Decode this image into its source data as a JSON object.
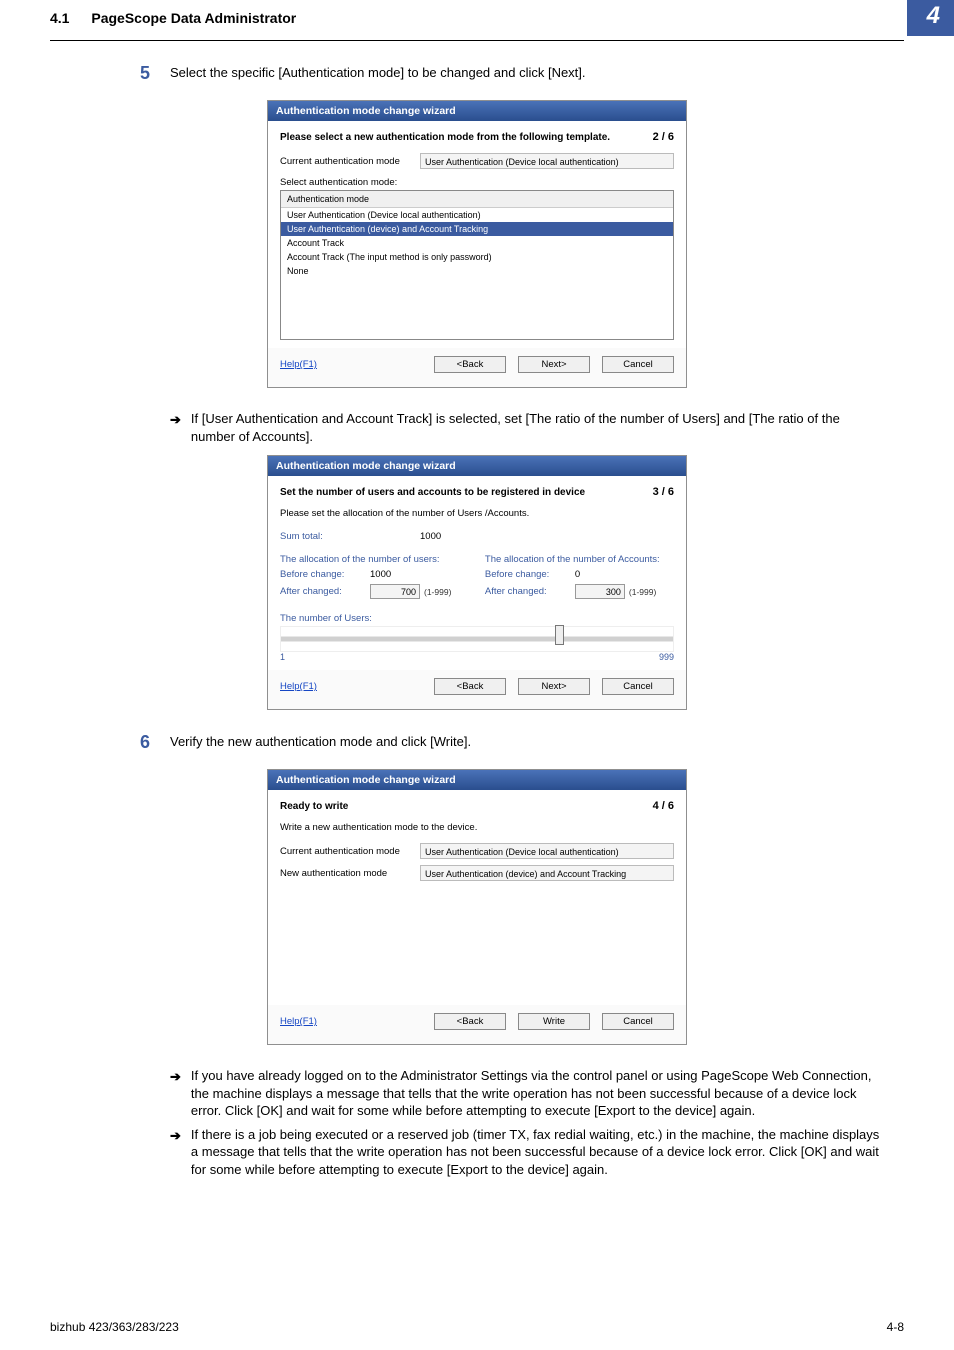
{
  "header": {
    "section": "4.1",
    "title": "PageScope Data Administrator",
    "chapter": "4"
  },
  "step5": {
    "num": "5",
    "text": "Select the specific [Authentication mode] to be changed and click [Next]."
  },
  "wizard1": {
    "title": "Authentication mode change wizard",
    "subtitle": "Please select a new authentication mode from the following template.",
    "page": "2 / 6",
    "current_label": "Current authentication mode",
    "current_value": "User Authentication (Device local authentication)",
    "select_label": "Select authentication mode:",
    "list_header": "Authentication mode",
    "items": [
      "User Authentication (Device local authentication)",
      "User Authentication (device) and Account Tracking",
      "Account Track",
      "Account Track (The input method is only password)",
      "None"
    ],
    "back": "<Back",
    "next": "Next>",
    "cancel": "Cancel",
    "help": "Help(F1)"
  },
  "arrow1": {
    "text": "If [User Authentication and Account Track] is selected, set [The ratio of the number of Users] and [The ratio of the number of Accounts]."
  },
  "wizard2": {
    "title": "Authentication mode change wizard",
    "subtitle": "Set the number of users and accounts to be registered in device",
    "page": "3 / 6",
    "caption": "Please set the allocation of the number of Users /Accounts.",
    "sum_label": "Sum total:",
    "sum_value": "1000",
    "users_heading": "The allocation of the number of users:",
    "accounts_heading": "The allocation of the number of Accounts:",
    "before_label": "Before change:",
    "after_label": "After changed:",
    "users_before": "1000",
    "users_after": "700",
    "users_range": "(1-999)",
    "accounts_before": "0",
    "accounts_after": "300",
    "accounts_range": "(1-999)",
    "slider_title": "The number of Users:",
    "slider_min": "1",
    "slider_max": "999",
    "back": "<Back",
    "next": "Next>",
    "cancel": "Cancel",
    "help": "Help(F1)"
  },
  "step6": {
    "num": "6",
    "text": "Verify the new authentication mode and click [Write]."
  },
  "wizard3": {
    "title": "Authentication mode change wizard",
    "subtitle": "Ready to write",
    "page": "4 / 6",
    "caption": "Write a new authentication mode to the device.",
    "current_label": "Current authentication mode",
    "current_value": "User Authentication (Device local authentication)",
    "new_label": "New authentication mode",
    "new_value": "User Authentication (device) and Account Tracking",
    "back": "<Back",
    "write": "Write",
    "cancel": "Cancel",
    "help": "Help(F1)"
  },
  "arrow2": {
    "text": "If you have already logged on to the Administrator Settings via the control panel or using PageScope Web Connection, the machine displays a message that tells that the write operation has not been successful because of a device lock error. Click [OK] and wait for some while before attempting to execute [Export to the device] again."
  },
  "arrow3": {
    "text": "If there is a job being executed or a reserved job (timer TX, fax redial waiting, etc.) in the machine, the machine displays a message that tells that the write operation has not been successful because of a device lock error. Click [OK] and wait for some while before attempting to execute [Export to the device] again."
  },
  "footer": {
    "left": "bizhub 423/363/283/223",
    "right": "4-8"
  },
  "arrow_glyph": "➔"
}
